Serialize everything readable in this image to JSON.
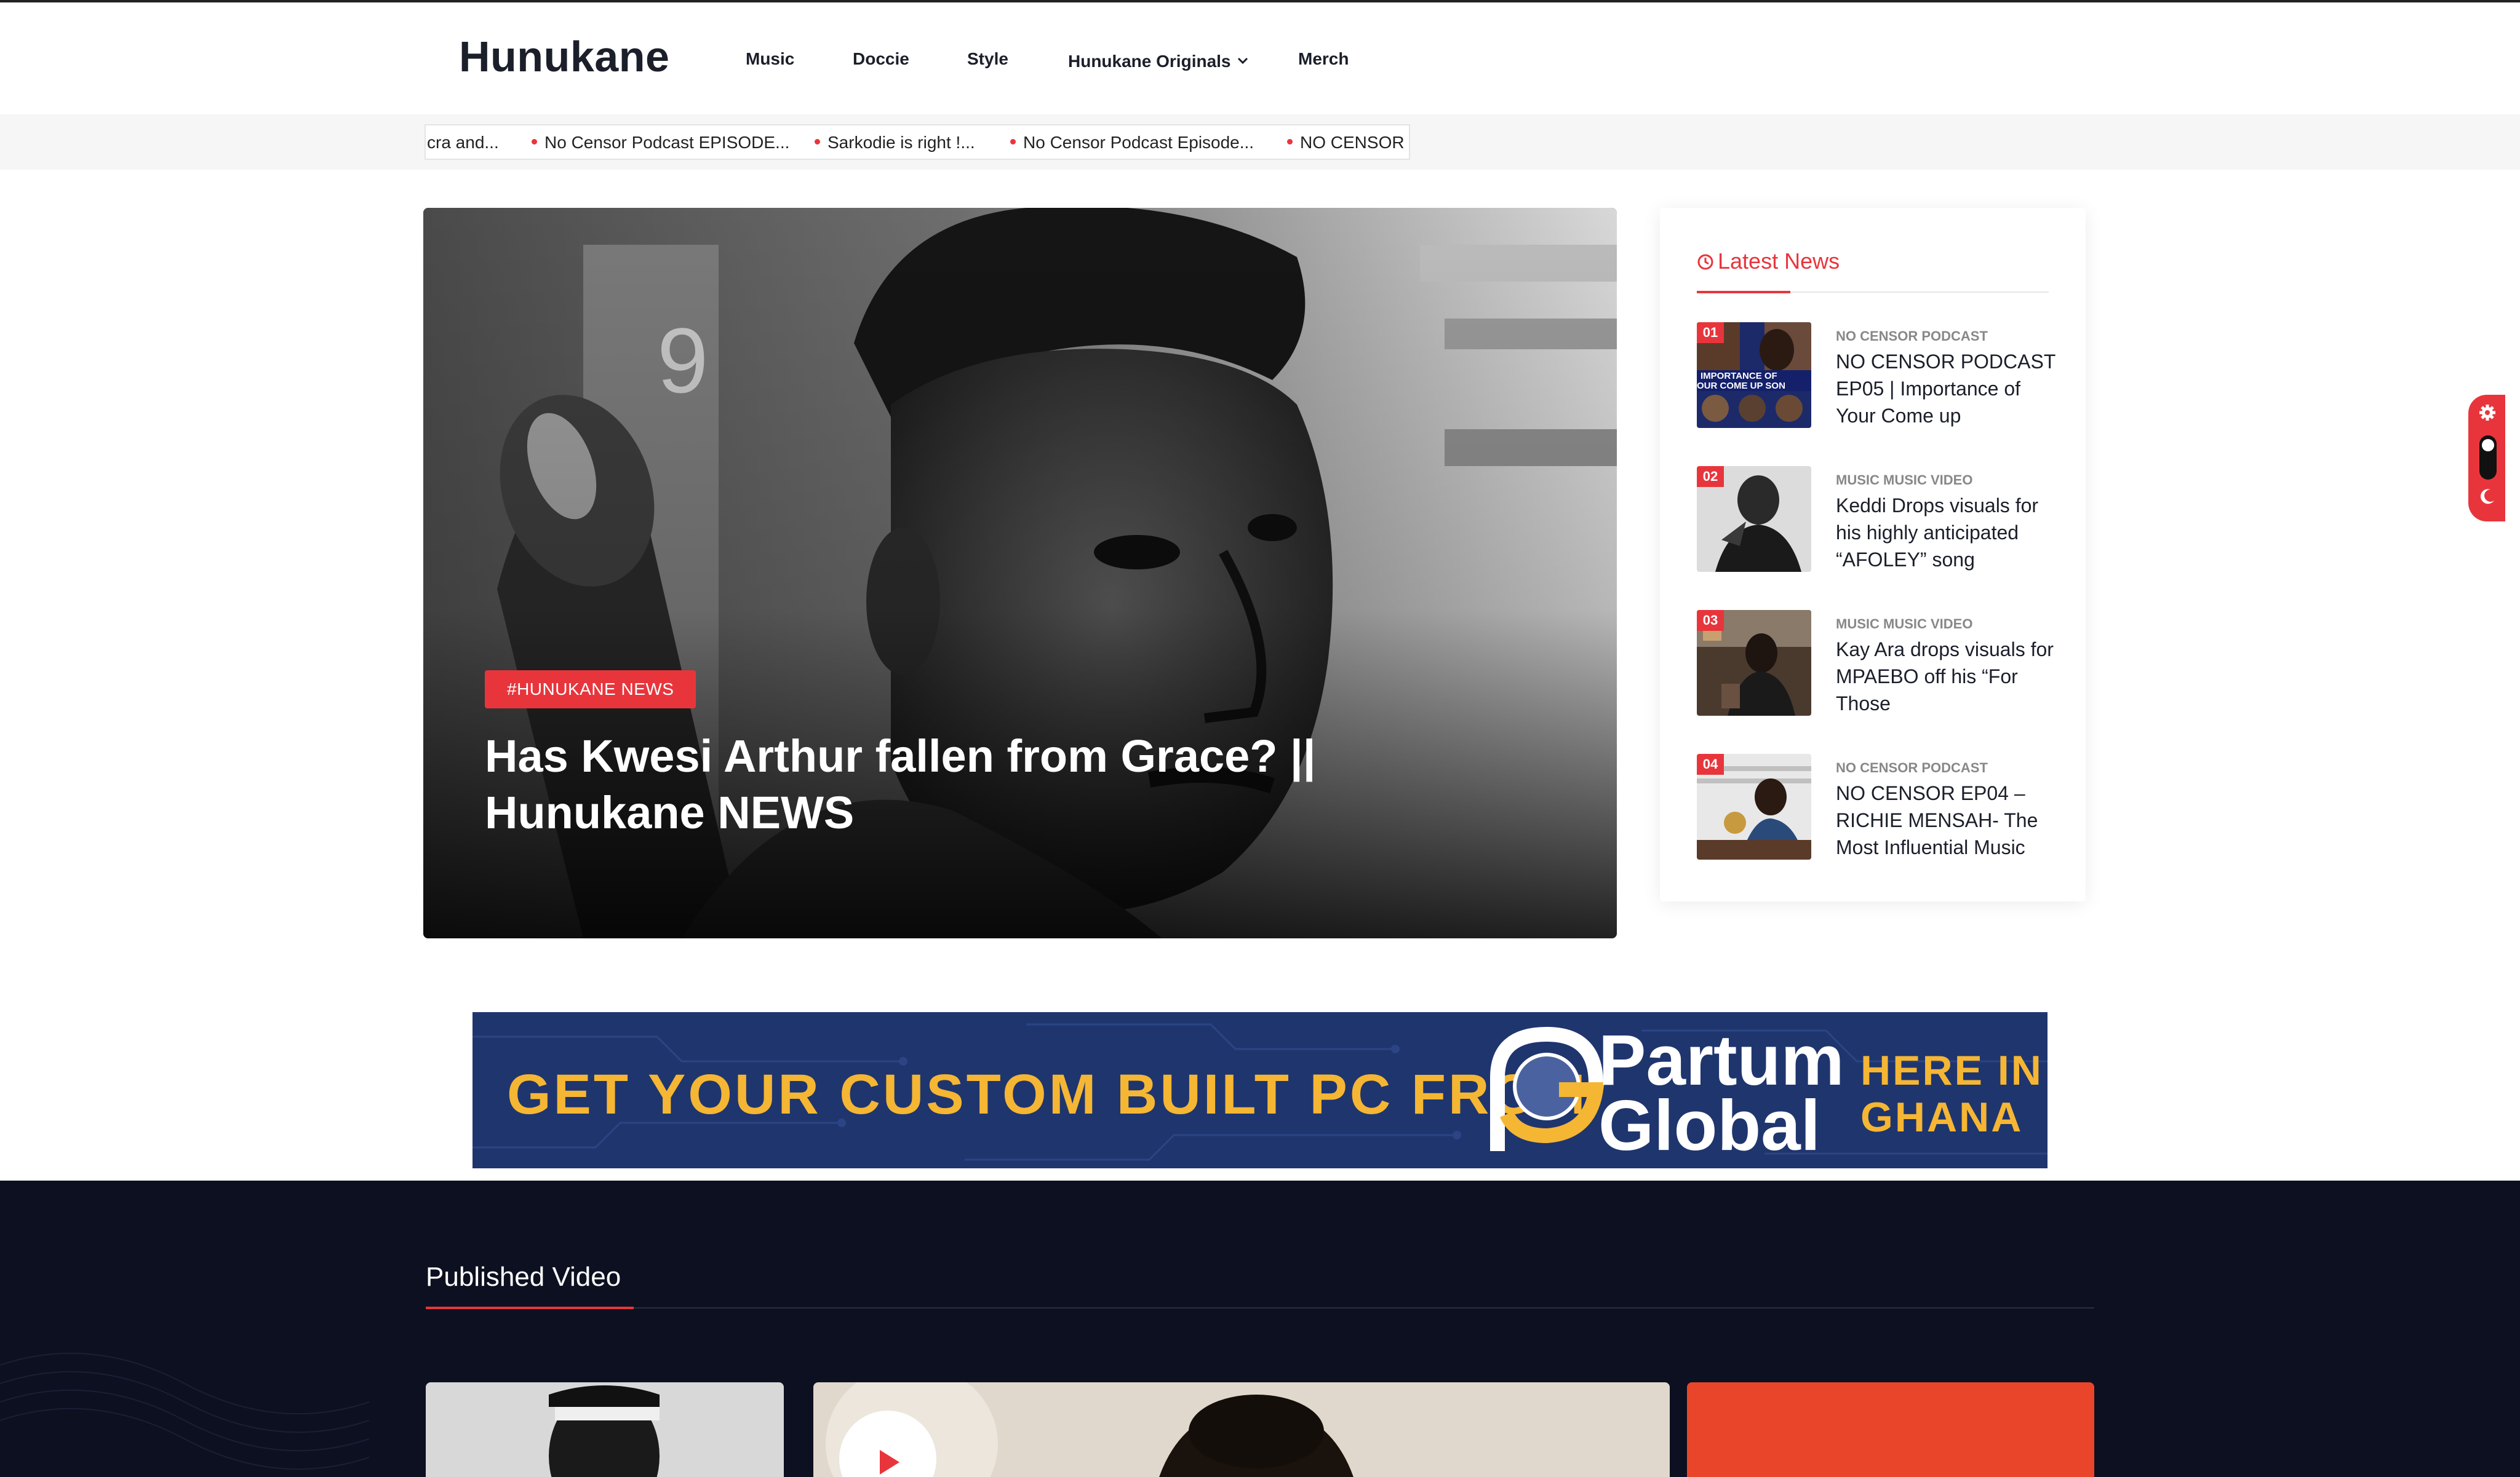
{
  "header": {
    "logo": "Hunukane",
    "nav": [
      {
        "label": "Music"
      },
      {
        "label": "Doccie"
      },
      {
        "label": "Style"
      },
      {
        "label": "Hunukane Originals",
        "has_dropdown": true
      },
      {
        "label": "Merch"
      }
    ]
  },
  "ticker": {
    "items": [
      "cra and...",
      "No Censor Podcast EPISODE...",
      "Sarkodie is right !...",
      "No Censor Podcast Episode...",
      "NO CENSOR P"
    ]
  },
  "hero": {
    "tag": "#HUNUKANE NEWS",
    "title": "Has Kwesi Arthur fallen from Grace? || Hunukane NEWS"
  },
  "latest": {
    "heading": "Latest News",
    "items": [
      {
        "num": "01",
        "category": "NO CENSOR PODCAST",
        "title": "NO CENSOR PODCAST EP05 | Importance of Your Come up",
        "thumb_text": "IMPORTANCE OF OUR COME UP SON"
      },
      {
        "num": "02",
        "category": "MUSIC MUSIC VIDEO",
        "title": "Keddi Drops visuals for his highly anticipated “AFOLEY” song"
      },
      {
        "num": "03",
        "category": "MUSIC MUSIC VIDEO",
        "title": "Kay Ara drops visuals for MPAEBO off his “For Those"
      },
      {
        "num": "04",
        "category": "NO CENSOR PODCAST",
        "title": "NO CENSOR EP04 – RICHIE MENSAH- The Most Influential Music"
      }
    ]
  },
  "banner": {
    "text": "GET YOUR CUSTOM BUILT PC FROM",
    "brand_line1": "Partum",
    "brand_line2": "Global",
    "right_line1": "HERE IN",
    "right_line2": "GHANA"
  },
  "videos": {
    "heading": "Published Video"
  },
  "colors": {
    "accent": "#e8353c",
    "dark_bg": "#0d1020",
    "banner_bg": "#1f356e",
    "banner_gold": "#f5b634"
  },
  "icons": [
    "chevron-down-icon",
    "clock-icon",
    "gear-icon",
    "moon-icon",
    "play-icon"
  ]
}
